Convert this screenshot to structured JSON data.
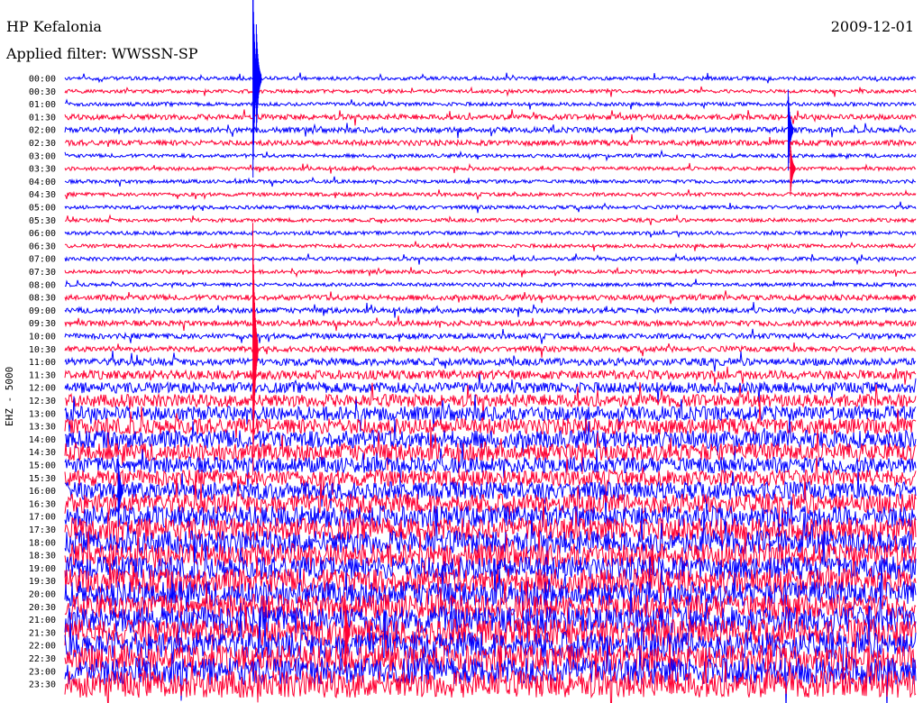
{
  "header": {
    "station": "HP Kefalonia",
    "date": "2009-12-01",
    "filter": "Applied filter: WWSSN-SP",
    "channel": "EHZ - 5000"
  },
  "chart_data": {
    "type": "line",
    "row_labels": [
      "00:00",
      "00:30",
      "01:00",
      "01:30",
      "02:00",
      "02:30",
      "03:00",
      "03:30",
      "04:00",
      "04:30",
      "05:00",
      "05:30",
      "06:00",
      "06:30",
      "07:00",
      "07:30",
      "08:00",
      "08:30",
      "09:00",
      "09:30",
      "10:00",
      "10:30",
      "11:00",
      "11:30",
      "12:00",
      "12:30",
      "13:00",
      "13:30",
      "14:00",
      "14:30",
      "15:00",
      "15:30",
      "16:00",
      "16:30",
      "17:00",
      "17:30",
      "18:00",
      "18:30",
      "19:00",
      "19:30",
      "20:00",
      "20:30",
      "21:00",
      "21:30",
      "22:00",
      "22:30",
      "23:00",
      "23:30"
    ],
    "trace_colors": [
      "#0000ff",
      "#ff0033"
    ],
    "noise_amplitude": [
      2,
      2,
      2,
      3,
      3,
      3,
      2,
      2,
      2,
      2,
      2,
      2,
      2,
      2,
      2,
      2,
      2,
      3,
      3,
      3,
      3,
      3,
      4,
      5,
      6,
      7,
      8,
      9,
      10,
      10,
      9,
      9,
      10,
      11,
      12,
      13,
      13,
      13,
      13,
      14,
      14,
      14,
      15,
      15,
      15,
      15,
      15,
      15
    ],
    "events": [
      {
        "row": 0,
        "minute": 26.5,
        "amplitude": 110
      },
      {
        "row": 0,
        "minute": 27.0,
        "amplitude": 60
      },
      {
        "row": 4,
        "minute": 102.0,
        "amplitude": 45
      },
      {
        "row": 7,
        "minute": 102.3,
        "amplitude": 30
      },
      {
        "row": 21,
        "minute": 26.5,
        "amplitude": 140
      },
      {
        "row": 32,
        "minute": 7.5,
        "amplitude": 40
      },
      {
        "row": 43,
        "minute": 39.5,
        "amplitude": 45
      }
    ]
  }
}
